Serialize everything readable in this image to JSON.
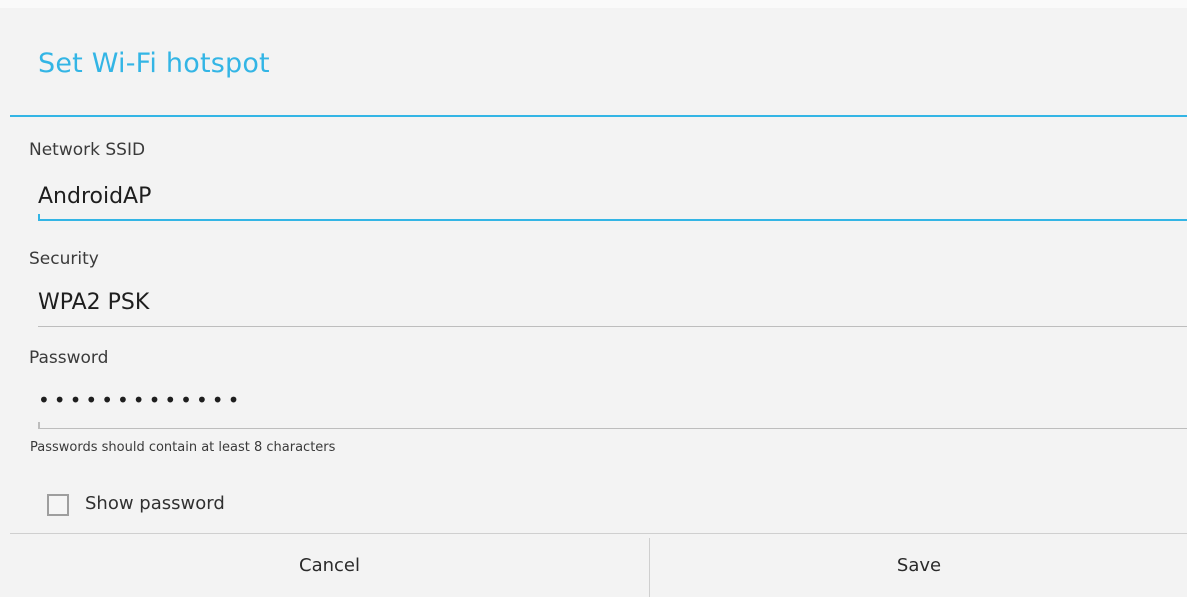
{
  "dialog": {
    "title": "Set Wi-Fi hotspot",
    "ssid_label": "Network SSID",
    "ssid_value": "AndroidAP",
    "security_label": "Security",
    "security_value": "WPA2 PSK",
    "password_label": "Password",
    "password_value": "•••••••••••••",
    "password_hint": "Passwords should contain at least 8 characters",
    "show_password_label": "Show password",
    "show_password_checked": false,
    "cancel_label": "Cancel",
    "save_label": "Save",
    "accent_color": "#33b5e5"
  }
}
